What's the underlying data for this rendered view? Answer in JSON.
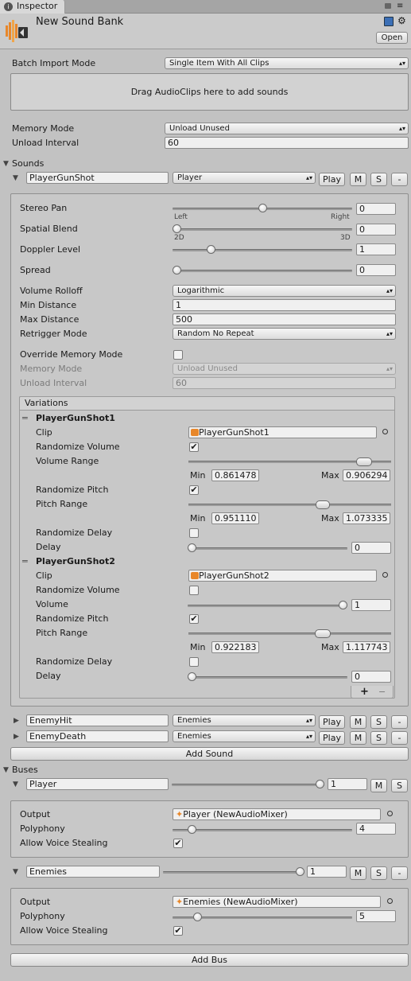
{
  "tab": {
    "title": "Inspector"
  },
  "header": {
    "title": "New Sound Bank",
    "open_label": "Open"
  },
  "bank": {
    "batch_import_label": "Batch Import Mode",
    "batch_import_value": "Single Item With All Clips",
    "drop_area_text": "Drag AudioClips here to add sounds",
    "memory_mode_label": "Memory Mode",
    "memory_mode_value": "Unload Unused",
    "unload_interval_label": "Unload Interval",
    "unload_interval_value": "60"
  },
  "sounds": {
    "section_label": "Sounds",
    "items": [
      {
        "name": "PlayerGunShot",
        "bus": "Player",
        "play": "Play",
        "mute": "M",
        "solo": "S",
        "remove": "-"
      },
      {
        "name": "EnemyHit",
        "bus": "Enemies",
        "play": "Play",
        "mute": "M",
        "solo": "S",
        "remove": "-"
      },
      {
        "name": "EnemyDeath",
        "bus": "Enemies",
        "play": "Play",
        "mute": "M",
        "solo": "S",
        "remove": "-"
      }
    ],
    "add_sound_label": "Add Sound"
  },
  "detail": {
    "stereo_pan_label": "Stereo Pan",
    "stereo_pan_value": "0",
    "stereo_left": "Left",
    "stereo_right": "Right",
    "stereo_pan_fraction": 0.5,
    "spatial_blend_label": "Spatial Blend",
    "spatial_blend_value": "0",
    "spatial_2d": "2D",
    "spatial_3d": "3D",
    "spatial_blend_fraction": 0,
    "doppler_label": "Doppler Level",
    "doppler_value": "1",
    "doppler_fraction": 0.2,
    "spread_label": "Spread",
    "spread_value": "0",
    "spread_fraction": 0,
    "volume_rolloff_label": "Volume Rolloff",
    "volume_rolloff_value": "Logarithmic",
    "min_distance_label": "Min Distance",
    "min_distance_value": "1",
    "max_distance_label": "Max Distance",
    "max_distance_value": "500",
    "retrigger_label": "Retrigger Mode",
    "retrigger_value": "Random No Repeat",
    "override_memory_label": "Override Memory Mode",
    "memory_mode_label": "Memory Mode",
    "memory_mode_value": "Unload Unused",
    "unload_interval_label": "Unload Interval",
    "unload_interval_value": "60",
    "variations_label": "Variations",
    "variations": [
      {
        "name": "PlayerGunShot1",
        "clip_label": "Clip",
        "clip_value": "PlayerGunShot1",
        "rand_volume_label": "Randomize Volume",
        "volume_label": "Volume Range",
        "vol_min": "0.861478",
        "vol_max": "0.906294",
        "rand_pitch_label": "Randomize Pitch",
        "pitch_label": "Pitch Range",
        "pitch_min": "0.951110",
        "pitch_max": "1.073335",
        "rand_delay_label": "Randomize Delay",
        "delay_label": "Delay",
        "delay_value": "0"
      },
      {
        "name": "PlayerGunShot2",
        "clip_label": "Clip",
        "clip_value": "PlayerGunShot2",
        "rand_volume_label": "Randomize Volume",
        "volume_label": "Volume",
        "volume_value": "1",
        "rand_pitch_label": "Randomize Pitch",
        "pitch_label": "Pitch Range",
        "pitch_min": "0.922183",
        "pitch_max": "1.117743",
        "rand_delay_label": "Randomize Delay",
        "delay_label": "Delay",
        "delay_value": "0"
      }
    ],
    "min_label": "Min",
    "max_label": "Max",
    "add_label": "+",
    "remove_label": "−"
  },
  "buses": {
    "section_label": "Buses",
    "items": [
      {
        "name": "Player",
        "volume": "1",
        "mute": "M",
        "solo": "S",
        "output_label": "Output",
        "output_value": "Player (NewAudioMixer)",
        "polyphony_label": "Polyphony",
        "polyphony_value": "4",
        "steal_label": "Allow Voice Stealing"
      },
      {
        "name": "Enemies",
        "volume": "1",
        "mute": "M",
        "solo": "S",
        "remove": "-",
        "output_label": "Output",
        "output_value": "Enemies (NewAudioMixer)",
        "polyphony_label": "Polyphony",
        "polyphony_value": "5",
        "steal_label": "Allow Voice Stealing"
      }
    ],
    "add_bus_label": "Add Bus"
  },
  "colors": {
    "background": "#c2c2c2",
    "panel": "#c8c8c8",
    "audio_icon": "#e8872a"
  },
  "icons": [
    "audio-source-icon",
    "lock-icon",
    "menu-icon",
    "help-book-icon",
    "gear-icon",
    "object-picker-icon",
    "drag-handle-icon",
    "foldout-arrow-icon",
    "checkmark-icon"
  ]
}
